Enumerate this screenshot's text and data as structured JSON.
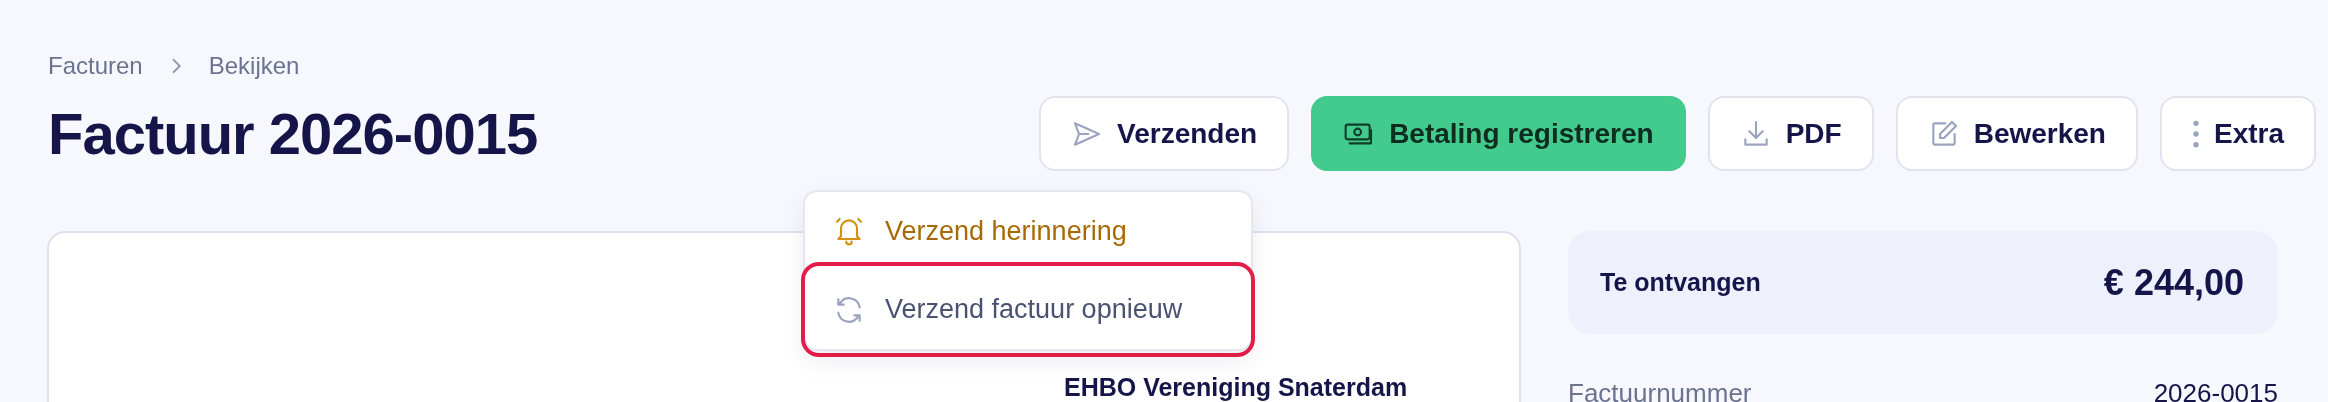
{
  "breadcrumb": [
    {
      "label": "Facturen"
    },
    {
      "label": "Bekijken"
    }
  ],
  "title": "Factuur 2026-0015",
  "actions": [
    {
      "kind": "send",
      "label": "Verzenden"
    },
    {
      "kind": "payment",
      "label": "Betaling registreren"
    },
    {
      "kind": "download",
      "label": "PDF"
    },
    {
      "kind": "edit",
      "label": "Bewerken"
    },
    {
      "kind": "more",
      "label": "Extra"
    }
  ],
  "send_menu": [
    {
      "kind": "reminder",
      "label": "Verzend herinnering",
      "selected": false
    },
    {
      "kind": "resend",
      "label": "Verzend factuur opnieuw",
      "selected": true
    }
  ],
  "invoice": {
    "sender": "EHBO Vereniging Snaterdam"
  },
  "summary": {
    "label": "Te ontvangen",
    "amount": "€ 244,00"
  },
  "details": [
    {
      "label": "Factuurnummer",
      "value": "2026-0015"
    }
  ]
}
